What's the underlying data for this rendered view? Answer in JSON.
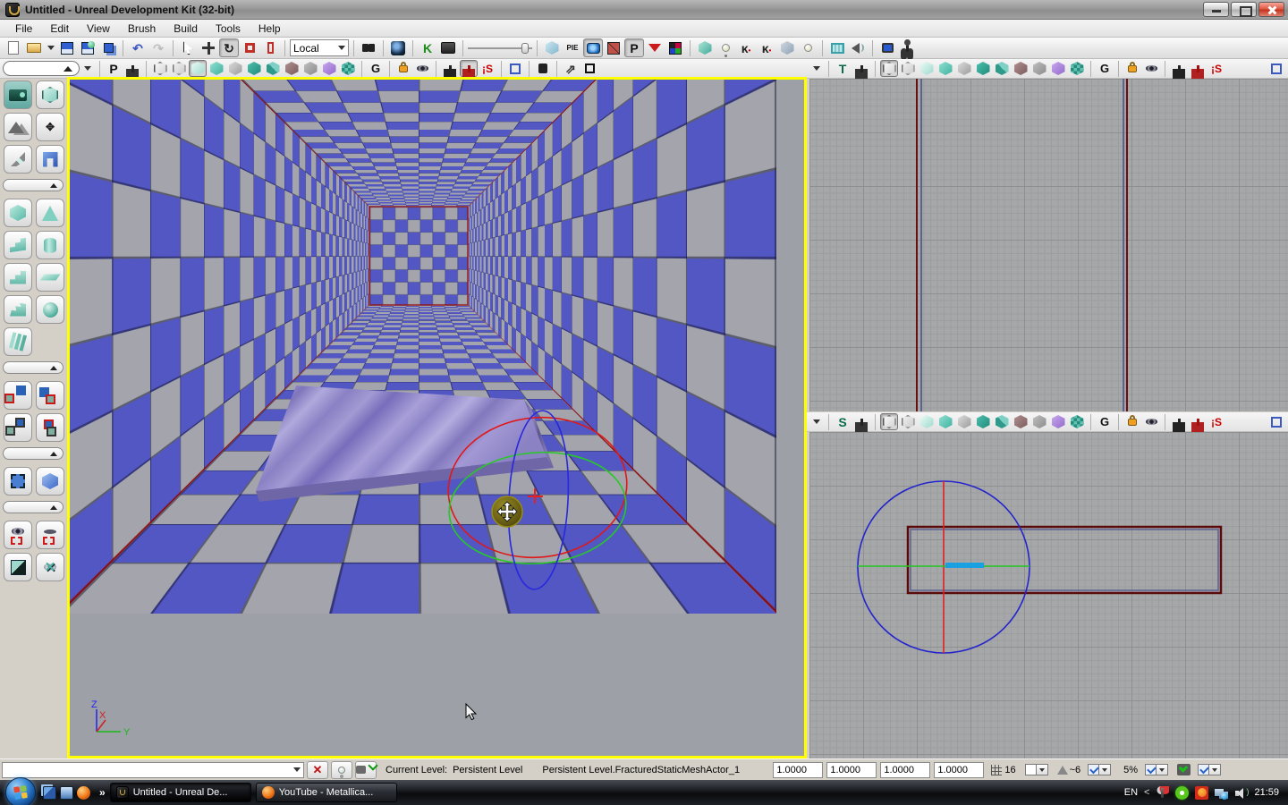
{
  "window": {
    "title": "Untitled - Unreal Development Kit (32-bit)"
  },
  "menu": {
    "items": [
      "File",
      "Edit",
      "View",
      "Brush",
      "Build",
      "Tools",
      "Help"
    ]
  },
  "toolbar": {
    "coordsys": "Local",
    "kismet_letter": "K",
    "pie_label": "PIE",
    "publish_letter": "P"
  },
  "viewports": {
    "perspective": {
      "letter": "P",
      "geom_letter": "G",
      "squint": "¡S"
    },
    "front": {
      "letter": "T",
      "geom_letter": "G",
      "squint": "¡S"
    },
    "side": {
      "letter": "S",
      "geom_letter": "G",
      "squint": "¡S"
    },
    "axis": {
      "x": "X",
      "y": "Y",
      "z": "Z"
    }
  },
  "statusbar": {
    "current_level_label": "Current Level:",
    "current_level_value": "Persistent Level",
    "selection": "Persistent Level.FracturedStaticMeshActor_1",
    "values": [
      "1.0000",
      "1.0000",
      "1.0000",
      "1.0000"
    ],
    "grid_size": "16",
    "rotation_snap": "~6",
    "autosave_pct": "5%"
  },
  "taskbar": {
    "overflow": "»",
    "tasks": [
      "Untitled - Unreal De...",
      "YouTube - Metallica..."
    ],
    "lang": "EN",
    "chevron_left": "<",
    "time": "21:59"
  }
}
